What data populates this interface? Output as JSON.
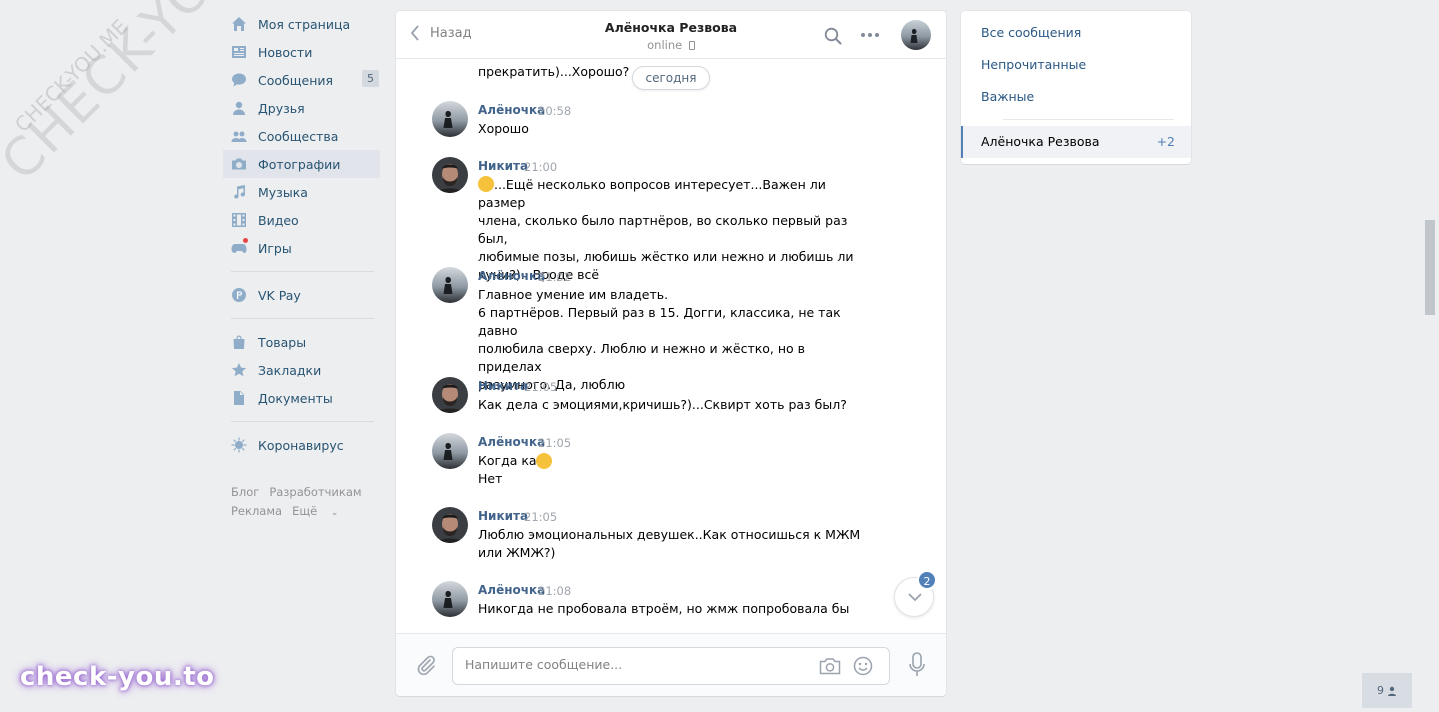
{
  "nav": {
    "items": [
      {
        "label": "Моя страница",
        "icon": "home-icon"
      },
      {
        "label": "Новости",
        "icon": "news-icon"
      },
      {
        "label": "Сообщения",
        "icon": "messages-icon",
        "badge": "5"
      },
      {
        "label": "Друзья",
        "icon": "friends-icon"
      },
      {
        "label": "Сообщества",
        "icon": "groups-icon"
      },
      {
        "label": "Фотографии",
        "icon": "camera-icon"
      },
      {
        "label": "Музыка",
        "icon": "music-icon"
      },
      {
        "label": "Видео",
        "icon": "video-icon"
      },
      {
        "label": "Игры",
        "icon": "gamepad-icon"
      },
      {
        "label": "VK Pay",
        "icon": "vkpay-icon"
      },
      {
        "label": "Товары",
        "icon": "bag-icon"
      },
      {
        "label": "Закладки",
        "icon": "star-icon"
      },
      {
        "label": "Документы",
        "icon": "document-icon"
      },
      {
        "label": "Коронавирус",
        "icon": "virus-icon"
      }
    ],
    "footer": [
      "Блог",
      "Разработчикам",
      "Реклама",
      "Ещё"
    ]
  },
  "chat": {
    "back_label": "Назад",
    "title": "Алёночка Резвова",
    "status": "online",
    "prev_text": "прекратить)...Хорошо?",
    "date_pill": "сегодня",
    "messages": [
      {
        "author": "Алёночка",
        "time": "20:58",
        "text": "Хорошо"
      },
      {
        "author": "Никита",
        "time": "21:00",
        "text": "...Ещё несколько вопросов интересует...Важен ли размер\nчлена, сколько было партнёров, во сколько первый раз был,\nлюбимые позы, любишь жёстко или нежно и любишь ли\nкуни?)...Вроде всё"
      },
      {
        "author": "Алёночка",
        "time": "21:02",
        "text": "Главное умение им владеть.\n6 партнёров. Первый раз в 15. Догги, классика, не так давно\nполюбила сверху. Люблю и нежно и жёстко, но в приделах\nразумного. Да, люблю"
      },
      {
        "author": "Никита",
        "time": "21:05",
        "text": "Как дела с эмоциями,кричишь?)...Сквирт хоть раз был?"
      },
      {
        "author": "Алёночка",
        "time": "21:05",
        "text": "Когда как\nНет"
      },
      {
        "author": "Никита",
        "time": "21:05",
        "text": "Люблю эмоциональных девушек..Как относишься к МЖМ\nили ЖМЖ?)"
      },
      {
        "author": "Алёночка",
        "time": "21:08",
        "text": "Никогда не пробовала втроём, но жмж попробовала бы"
      }
    ],
    "unread_badge": "2",
    "composer_placeholder": "Напишите сообщение..."
  },
  "right_panel": {
    "all": "Все сообщения",
    "unread": "Непрочитанные",
    "important": "Важные",
    "conversation": {
      "name": "Алёночка Резвова",
      "count": "+2"
    }
  },
  "bottom_badge": "9",
  "watermarks": {
    "big": "CHECK-YOU.ME",
    "small": "CHECK-YOU.ME",
    "bottom": "check-you.to"
  },
  "colors": {
    "accent": "#5181b8",
    "link": "#2a5885",
    "author": "#42648b",
    "background": "#edeef0"
  }
}
